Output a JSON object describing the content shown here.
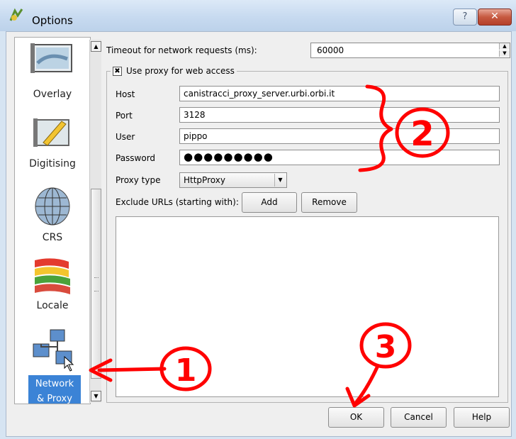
{
  "window": {
    "title": "Options",
    "help_glyph": "?",
    "close_glyph": "✕"
  },
  "sidebar": {
    "items": [
      {
        "label": "Overlay",
        "icon": "overlay-map-icon"
      },
      {
        "label": "Digitising",
        "icon": "digitising-pencil-icon"
      },
      {
        "label": "CRS",
        "icon": "globe-grid-icon"
      },
      {
        "label": "Locale",
        "icon": "flags-icon"
      },
      {
        "label": "Network",
        "label2": "& Proxy",
        "icon": "network-computers-icon",
        "selected": true
      }
    ]
  },
  "network": {
    "timeout_label": "Timeout for network requests (ms):",
    "timeout_value": "60000",
    "use_proxy_label": "Use proxy for web access",
    "use_proxy_checked": "✖",
    "fields": {
      "host_label": "Host",
      "host_value": "canistracci_proxy_server.urbi.orbi.it",
      "port_label": "Port",
      "port_value": "3128",
      "user_label": "User",
      "user_value": "pippo",
      "password_label": "Password",
      "password_value": "●●●●●●●●●",
      "proxy_type_label": "Proxy type",
      "proxy_type_value": "HttpProxy"
    },
    "exclude_label": "Exclude URLs (starting with):",
    "add_label": "Add",
    "remove_label": "Remove"
  },
  "buttons": {
    "ok": "OK",
    "cancel": "Cancel",
    "help": "Help"
  },
  "annotations": {
    "one": "1",
    "two": "2",
    "three": "3",
    "color": "#ff0000"
  }
}
